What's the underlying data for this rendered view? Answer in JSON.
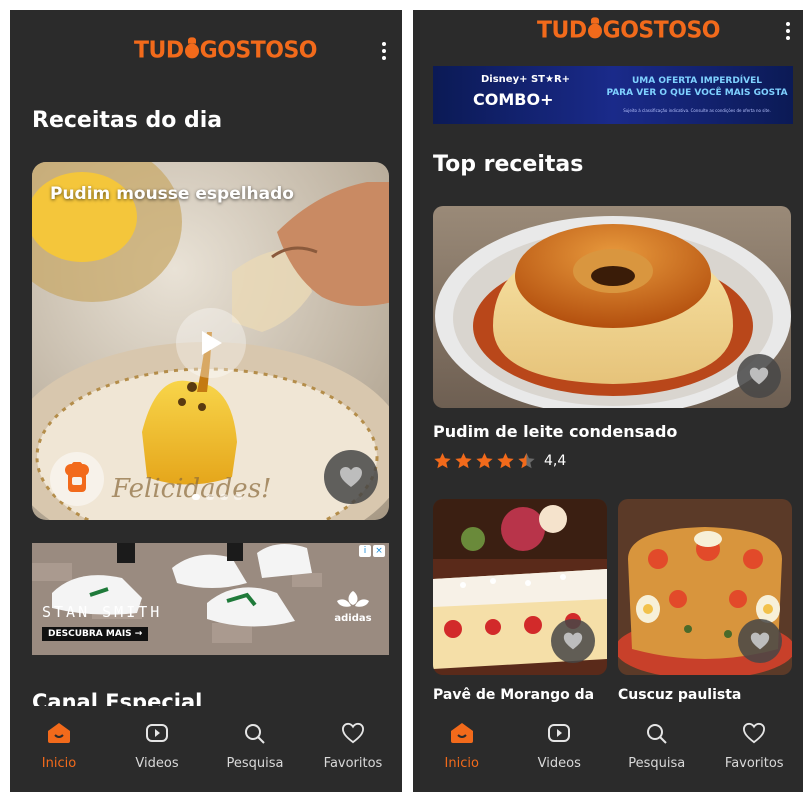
{
  "brand": {
    "logo_text_left": "TUD",
    "logo_text_right": "GOSTOSO",
    "accent": "#f26a1b"
  },
  "left": {
    "section_title": "Receitas do dia",
    "featured": {
      "title": "Pudim mousse espelhado",
      "cta_text": "Felicidades!"
    },
    "ad": {
      "slogan": "STAN SMITH",
      "cta": "DESCUBRA MAIS →",
      "brand": "adidas"
    },
    "next_section_title": "Canal Especial"
  },
  "right": {
    "banner": {
      "brand": "Disney+ ST★R+",
      "product": "COMBO+",
      "line1": "UMA OFERTA IMPERDÍVEL",
      "line2": "PARA VER O QUE VOCÊ MAIS GOSTA",
      "fineprint": "Sujeito à classificação indicativa. Consulte as condições de oferta no site."
    },
    "section_title": "Top receitas",
    "top_recipe": {
      "title": "Pudim de leite condensado",
      "rating": "4,4",
      "rating_value": 4.4
    },
    "grid": [
      {
        "title": "Pavê de Morango da"
      },
      {
        "title": "Cuscuz paulista"
      }
    ]
  },
  "nav": [
    {
      "label": "Inicio",
      "icon": "home-icon",
      "active": true
    },
    {
      "label": "Videos",
      "icon": "play-icon",
      "active": false
    },
    {
      "label": "Pesquisa",
      "icon": "search-icon",
      "active": false
    },
    {
      "label": "Favoritos",
      "icon": "heart-icon",
      "active": false
    }
  ],
  "colors": {
    "background": "#2b2b2b",
    "accent": "#f26a1b",
    "star": "#f26a1b",
    "caramel": "#c8621a"
  }
}
